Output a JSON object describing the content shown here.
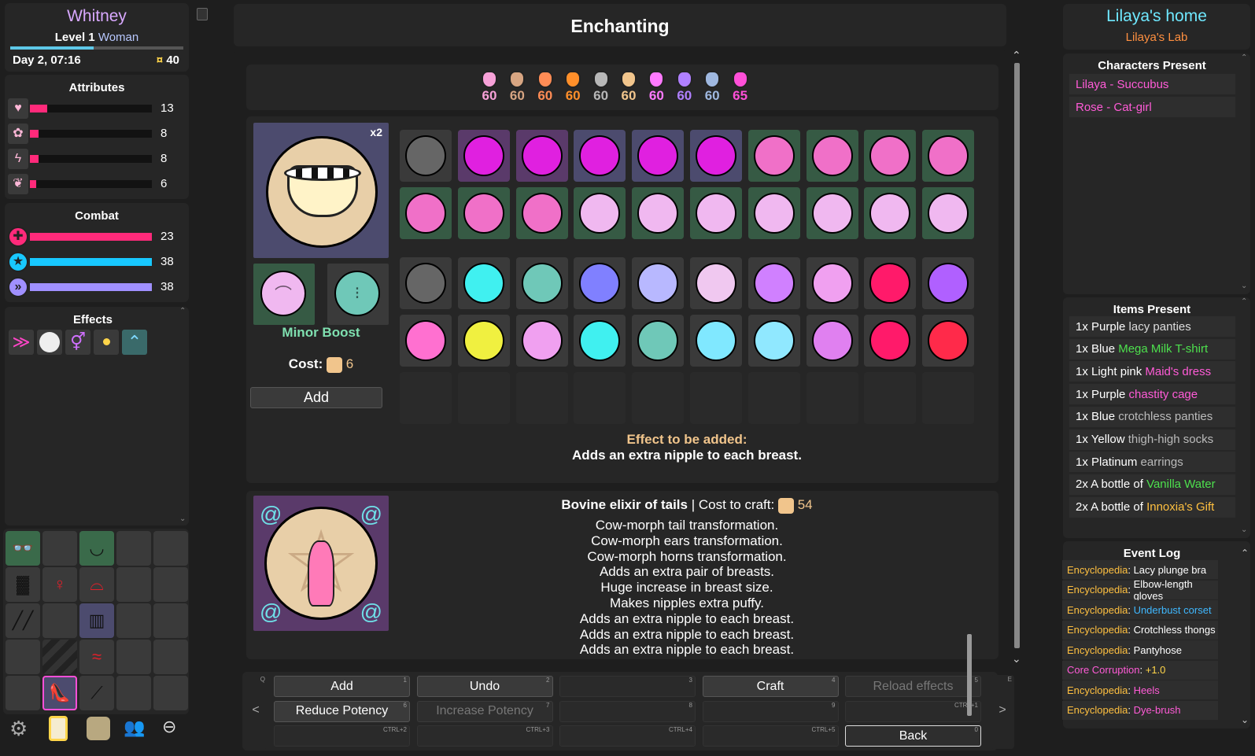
{
  "player": {
    "name": "Whitney",
    "level_label": "Level 1",
    "gender": "Woman",
    "datetime": "Day 2, 07:16",
    "money": "40",
    "money_icon": "¤"
  },
  "attributes": {
    "title": "Attributes",
    "items": [
      {
        "icon": "heart-icon",
        "value": "13",
        "fill": 0.14,
        "color": "#ff2a7a"
      },
      {
        "icon": "brain-icon",
        "value": "8",
        "fill": 0.07,
        "color": "#ff2a7a"
      },
      {
        "icon": "lightning-icon",
        "value": "8",
        "fill": 0.07,
        "color": "#ff2a7a"
      },
      {
        "icon": "wings-icon",
        "value": "6",
        "fill": 0.05,
        "color": "#ff2a7a"
      }
    ]
  },
  "combat": {
    "title": "Combat",
    "items": [
      {
        "icon": "health-icon",
        "value": "23",
        "fill": 1.0,
        "color": "#ff2a7a"
      },
      {
        "icon": "mana-icon",
        "value": "38",
        "fill": 1.0,
        "color": "#18c8ff"
      },
      {
        "icon": "energy-icon",
        "value": "38",
        "fill": 1.0,
        "color": "#a090ff"
      }
    ]
  },
  "effects": {
    "title": "Effects"
  },
  "header": {
    "title": "Enchanting"
  },
  "essences": [
    {
      "value": "60",
      "color": "#f7a1d8"
    },
    {
      "value": "60",
      "color": "#d7a582"
    },
    {
      "value": "60",
      "color": "#ff8c55"
    },
    {
      "value": "60",
      "color": "#ff8f2a"
    },
    {
      "value": "60",
      "color": "#b7b7b7"
    },
    {
      "value": "60",
      "color": "#f1c58c"
    },
    {
      "value": "60",
      "color": "#ff7aff"
    },
    {
      "value": "60",
      "color": "#b080ff"
    },
    {
      "value": "60",
      "color": "#9fb8e0"
    },
    {
      "value": "65",
      "color": "#ff4fd8"
    }
  ],
  "ingredient": {
    "count": "x2",
    "potency_label": "Minor Boost",
    "cost_label": "Cost:",
    "cost_value": "6",
    "add_label": "Add"
  },
  "effect_preview": {
    "heading": "Effect to be added:",
    "text": "Adds an extra nipple to each breast."
  },
  "result": {
    "name": "Bovine elixir of tails",
    "sep": " | ",
    "cost_label": "Cost to craft:",
    "cost_value": "54",
    "effects": [
      "Cow-morph tail transformation.",
      "Cow-morph ears transformation.",
      "Cow-morph horns transformation.",
      "Adds an extra pair of breasts.",
      "Huge increase in breast size.",
      "Makes nipples extra puffy.",
      "Adds an extra nipple to each breast.",
      "Adds an extra nipple to each breast.",
      "Adds an extra nipple to each breast."
    ]
  },
  "actions": {
    "row1": [
      {
        "label": "Add",
        "key": "1"
      },
      {
        "label": "Undo",
        "key": "2"
      },
      {
        "label": "",
        "key": "3"
      },
      {
        "label": "Craft",
        "key": "4"
      },
      {
        "label": "Reload effects",
        "key": "5"
      }
    ],
    "row2": [
      {
        "label": "Reduce Potency",
        "key": "6"
      },
      {
        "label": "Increase Potency",
        "key": "7"
      },
      {
        "label": "",
        "key": "8"
      },
      {
        "label": "",
        "key": "9"
      },
      {
        "label": "",
        "key": "CTRL+1"
      }
    ],
    "row3": [
      {
        "label": "",
        "key": "CTRL+2"
      },
      {
        "label": "",
        "key": "CTRL+3"
      },
      {
        "label": "",
        "key": "CTRL+4"
      },
      {
        "label": "",
        "key": "CTRL+5"
      },
      {
        "label": "Back",
        "key": "0"
      }
    ],
    "left_key": "Q",
    "right_key": "E",
    "left_arrow": "<",
    "right_arrow": ">"
  },
  "location": {
    "name": "Lilaya's home",
    "sub": "Lilaya's Lab"
  },
  "characters": {
    "title": "Characters Present",
    "items": [
      {
        "name": "Lilaya",
        "dash": " - ",
        "race": "Succubus"
      },
      {
        "name": "Rose",
        "dash": " - ",
        "race": "Cat-girl"
      }
    ]
  },
  "items_present": {
    "title": "Items Present",
    "items": [
      {
        "pre": "1x Purple ",
        "name": "lacy panties",
        "color": "#dddddd"
      },
      {
        "pre": "1x Blue ",
        "name": "Mega Milk T-shirt",
        "color": "#4de04d"
      },
      {
        "pre": "1x Light pink ",
        "name": "Maid's dress",
        "color": "#ff5bd7"
      },
      {
        "pre": "1x Purple ",
        "name": "chastity cage",
        "color": "#ff5bd7"
      },
      {
        "pre": "1x Blue ",
        "name": "crotchless panties",
        "color": "#bbbbbb"
      },
      {
        "pre": "1x Yellow ",
        "name": "thigh-high socks",
        "color": "#bbbbbb"
      },
      {
        "pre": "1x Platinum ",
        "name": "earrings",
        "color": "#bbbbbb"
      },
      {
        "pre": "2x A bottle of ",
        "name": "Vanilla Water",
        "color": "#4de04d"
      },
      {
        "pre": "2x A bottle of ",
        "name": "Innoxia's Gift",
        "color": "#ffc040"
      }
    ]
  },
  "event_log": {
    "title": "Event Log",
    "items": [
      {
        "a": "Encyclopedia",
        "b": "Lacy plunge bra",
        "ac": "#ffc040",
        "bc": "#ffffff"
      },
      {
        "a": "Encyclopedia",
        "b": "Elbow-length gloves",
        "ac": "#ffc040",
        "bc": "#ffffff"
      },
      {
        "a": "Encyclopedia",
        "b": "Underbust corset",
        "ac": "#ffc040",
        "bc": "#3fb8ff"
      },
      {
        "a": "Encyclopedia",
        "b": "Crotchless thongs",
        "ac": "#ffc040",
        "bc": "#ffffff"
      },
      {
        "a": "Encyclopedia",
        "b": "Pantyhose",
        "ac": "#ffc040",
        "bc": "#ffffff"
      },
      {
        "a": "Core Corruption",
        "b": "+1.0",
        "ac": "#ff5bd7",
        "bc": "#ffd54a"
      },
      {
        "a": "Encyclopedia",
        "b": "Heels",
        "ac": "#ffc040",
        "bc": "#ff5bd7"
      },
      {
        "a": "Encyclopedia",
        "b": "Dye-brush",
        "ac": "#ffc040",
        "bc": "#ff5bd7"
      }
    ]
  }
}
